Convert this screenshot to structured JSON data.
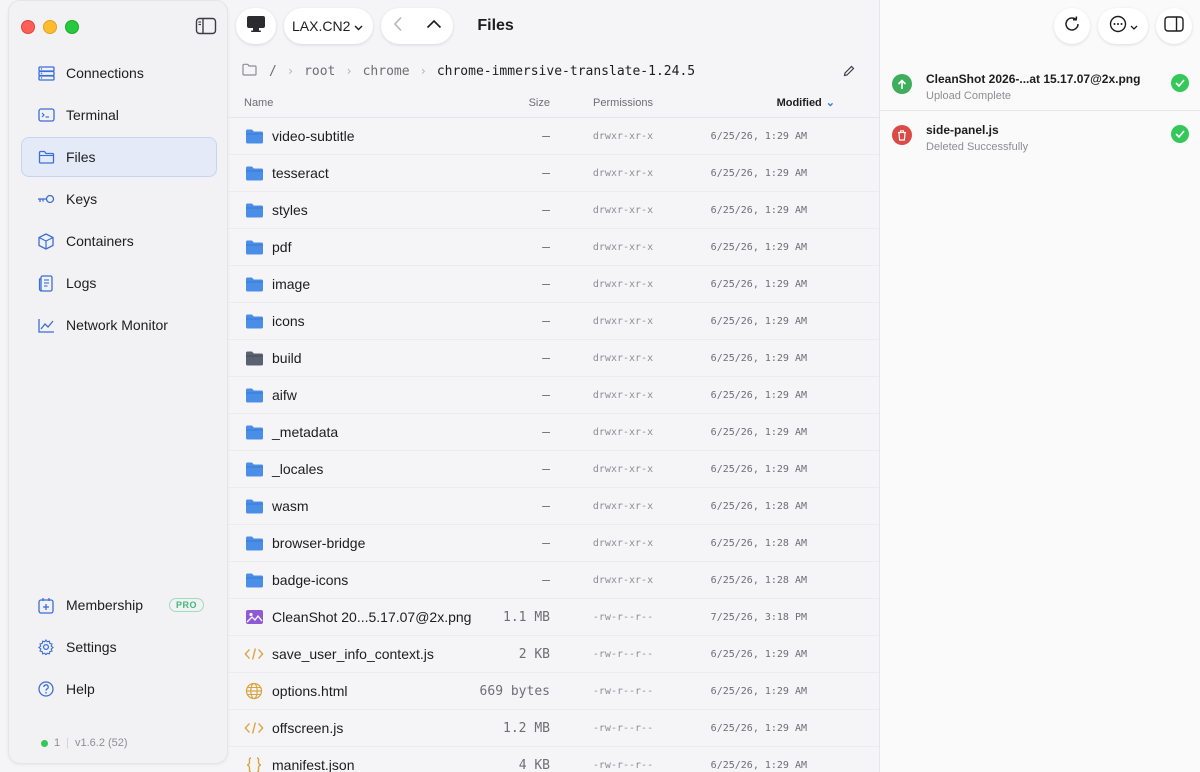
{
  "window": {
    "title": "Files"
  },
  "toolbar": {
    "host": "LAX.CN2"
  },
  "sidebar": {
    "items": [
      {
        "label": "Connections",
        "icon": "connections-icon"
      },
      {
        "label": "Terminal",
        "icon": "terminal-icon"
      },
      {
        "label": "Files",
        "icon": "folder-icon",
        "active": true
      },
      {
        "label": "Keys",
        "icon": "key-icon"
      },
      {
        "label": "Containers",
        "icon": "cube-icon"
      },
      {
        "label": "Logs",
        "icon": "logs-icon"
      },
      {
        "label": "Network Monitor",
        "icon": "chart-line-icon"
      }
    ],
    "bottom": [
      {
        "label": "Membership",
        "icon": "membership-icon",
        "badge": "PRO"
      },
      {
        "label": "Settings",
        "icon": "gear-icon"
      },
      {
        "label": "Help",
        "icon": "help-icon"
      }
    ],
    "status_count": "1",
    "version": "v1.6.2 (52)"
  },
  "breadcrumb": {
    "root_sep": "/",
    "parts": [
      "root",
      "chrome",
      "chrome-immersive-translate-1.24.5"
    ]
  },
  "table": {
    "headers": {
      "name": "Name",
      "size": "Size",
      "permissions": "Permissions",
      "modified": "Modified"
    },
    "rows": [
      {
        "name": "video-subtitle",
        "type": "folder",
        "size": "—",
        "perm": "drwxr-xr-x",
        "modified": "6/25/26, 1:29 AM"
      },
      {
        "name": "tesseract",
        "type": "folder",
        "size": "—",
        "perm": "drwxr-xr-x",
        "modified": "6/25/26, 1:29 AM"
      },
      {
        "name": "styles",
        "type": "folder",
        "size": "—",
        "perm": "drwxr-xr-x",
        "modified": "6/25/26, 1:29 AM"
      },
      {
        "name": "pdf",
        "type": "folder",
        "size": "—",
        "perm": "drwxr-xr-x",
        "modified": "6/25/26, 1:29 AM"
      },
      {
        "name": "image",
        "type": "folder",
        "size": "—",
        "perm": "drwxr-xr-x",
        "modified": "6/25/26, 1:29 AM"
      },
      {
        "name": "icons",
        "type": "folder",
        "size": "—",
        "perm": "drwxr-xr-x",
        "modified": "6/25/26, 1:29 AM"
      },
      {
        "name": "build",
        "type": "folder-dark",
        "size": "—",
        "perm": "drwxr-xr-x",
        "modified": "6/25/26, 1:29 AM"
      },
      {
        "name": "aifw",
        "type": "folder",
        "size": "—",
        "perm": "drwxr-xr-x",
        "modified": "6/25/26, 1:29 AM"
      },
      {
        "name": "_metadata",
        "type": "folder",
        "size": "—",
        "perm": "drwxr-xr-x",
        "modified": "6/25/26, 1:29 AM"
      },
      {
        "name": "_locales",
        "type": "folder",
        "size": "—",
        "perm": "drwxr-xr-x",
        "modified": "6/25/26, 1:29 AM"
      },
      {
        "name": "wasm",
        "type": "folder",
        "size": "—",
        "perm": "drwxr-xr-x",
        "modified": "6/25/26, 1:28 AM"
      },
      {
        "name": "browser-bridge",
        "type": "folder",
        "size": "—",
        "perm": "drwxr-xr-x",
        "modified": "6/25/26, 1:28 AM"
      },
      {
        "name": "badge-icons",
        "type": "folder",
        "size": "—",
        "perm": "drwxr-xr-x",
        "modified": "6/25/26, 1:28 AM"
      },
      {
        "name": "CleanShot 20...5.17.07@2x.png",
        "type": "image",
        "size": "1.1 MB",
        "perm": "-rw-r--r--",
        "modified": "7/25/26, 3:18 PM"
      },
      {
        "name": "save_user_info_context.js",
        "type": "code",
        "size": "2 KB",
        "perm": "-rw-r--r--",
        "modified": "6/25/26, 1:29 AM"
      },
      {
        "name": "options.html",
        "type": "globe",
        "size": "669 bytes",
        "perm": "-rw-r--r--",
        "modified": "6/25/26, 1:29 AM"
      },
      {
        "name": "offscreen.js",
        "type": "code",
        "size": "1.2 MB",
        "perm": "-rw-r--r--",
        "modified": "6/25/26, 1:29 AM"
      },
      {
        "name": "manifest.json",
        "type": "json",
        "size": "4 KB",
        "perm": "-rw-r--r--",
        "modified": "6/25/26, 1:29 AM"
      }
    ]
  },
  "transfers": [
    {
      "name": "CleanShot 2026-...at 15.17.07@2x.png",
      "status": "Upload Complete",
      "kind": "upload"
    },
    {
      "name": "side-panel.js",
      "status": "Deleted Successfully",
      "kind": "delete"
    }
  ],
  "colors": {
    "accent": "#3a7bf0",
    "folder": "#4a8ee8",
    "folder_dark": "#5a6272",
    "success": "#34c759",
    "upload": "#3fae5c",
    "delete": "#d94b44"
  }
}
